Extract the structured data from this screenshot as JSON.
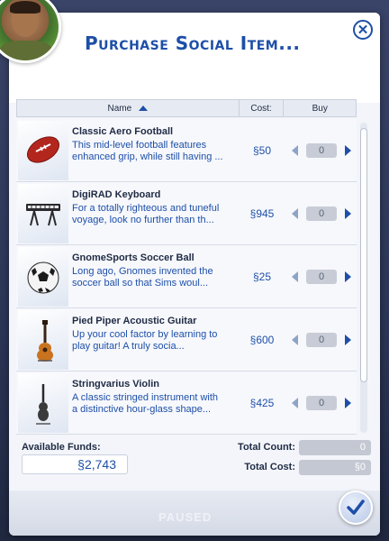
{
  "dialog": {
    "title": "Purchase Social Item...",
    "close_icon": "close-icon"
  },
  "columns": {
    "name": "Name",
    "cost": "Cost:",
    "buy": "Buy",
    "sort_icon": "sort-ascending-icon"
  },
  "items": [
    {
      "name": "Classic Aero Football",
      "desc_line1": "This mid-level football features",
      "desc_line2": "enhanced grip, while still having ...",
      "cost": "§50",
      "qty": "0",
      "icon": "football-icon"
    },
    {
      "name": "DigiRAD Keyboard",
      "desc_line1": "For a totally righteous and tuneful",
      "desc_line2": "voyage, look no further than th...",
      "cost": "§945",
      "qty": "0",
      "icon": "keyboard-icon"
    },
    {
      "name": "GnomeSports Soccer Ball",
      "desc_line1": "Long ago, Gnomes invented the",
      "desc_line2": "soccer ball so that Sims woul...",
      "cost": "§25",
      "qty": "0",
      "icon": "soccer-ball-icon"
    },
    {
      "name": "Pied Piper Acoustic Guitar",
      "desc_line1": "Up your cool factor by learning to",
      "desc_line2": "play guitar! A truly socia...",
      "cost": "§600",
      "qty": "0",
      "icon": "guitar-icon"
    },
    {
      "name": "Stringvarius Violin",
      "desc_line1": "A classic stringed instrument with",
      "desc_line2": "a distinctive hour-glass shape...",
      "cost": "§425",
      "qty": "0",
      "icon": "violin-icon"
    }
  ],
  "footer": {
    "funds_label": "Available Funds:",
    "funds_value": "§2,743",
    "total_count_label": "Total Count:",
    "total_count_value": "0",
    "total_cost_label": "Total Cost:",
    "total_cost_value": "§0"
  },
  "status": {
    "paused": "PAUSED"
  },
  "colors": {
    "accent": "#1d4fa8",
    "panel": "#f3f5fa",
    "background": "#2b3556"
  }
}
